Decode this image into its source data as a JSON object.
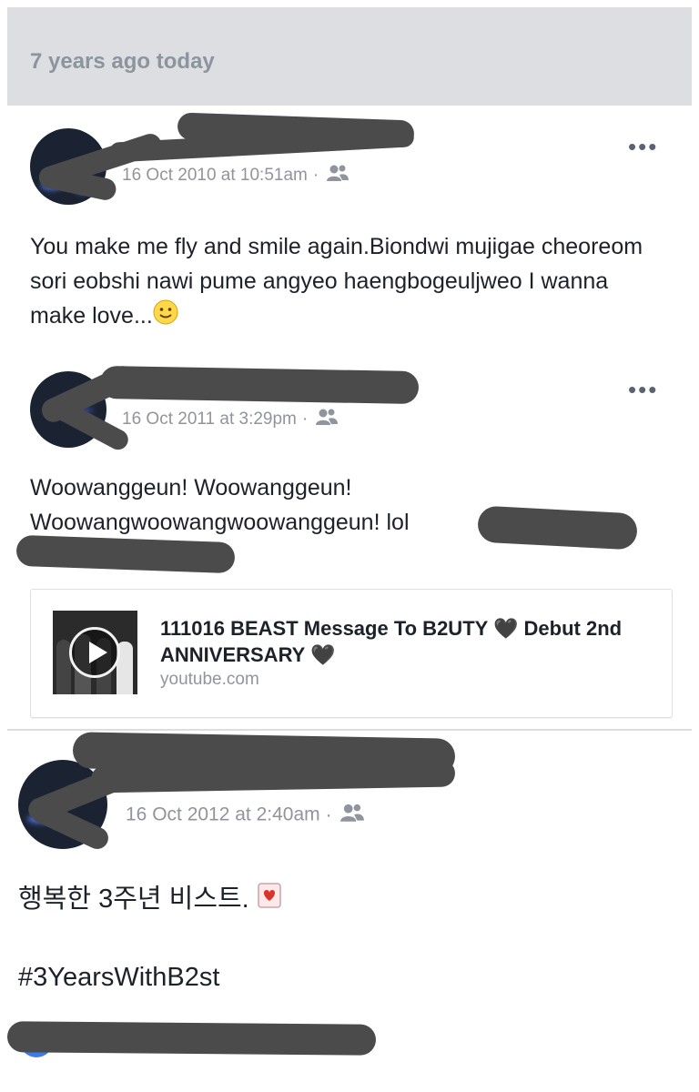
{
  "header": {
    "title": "7 years ago today"
  },
  "posts": [
    {
      "timestamp": "16 Oct 2010 at 10:51am",
      "separator": "·",
      "audience_icon": "friends-icon",
      "more_label": "•••",
      "text": "You make me fly and smile again.Biondwi mujigae cheoreom sori eobshi nawi pume angyeo haengbogeuljweo I wanna make love...",
      "emoji": "slightly-smiling-face"
    },
    {
      "timestamp": "16 Oct 2011 at 3:29pm",
      "separator": "·",
      "audience_icon": "friends-icon",
      "more_label": "•••",
      "text": "Woowanggeun! Woowanggeun! Woowangwoowangwoowanggeun! lol",
      "link": {
        "title": "111016 BEAST Message To B2UTY 🖤 Debut 2nd ANNIVERSARY 🖤",
        "domain": "youtube.com",
        "thumbnail_icon": "play-icon"
      }
    },
    {
      "timestamp": "16 Oct 2012 at 2:40am",
      "separator": "·",
      "audience_icon": "friends-icon",
      "line1": "행복한 3주년 비스트.",
      "emoji": "love-letter",
      "hashtag": "#3YearsWithB2st"
    }
  ],
  "colors": {
    "header_bg": "#dcdee1",
    "text": "#1d2129",
    "meta": "#90949c",
    "redaction": "#4b4b4b",
    "accent": "#3b7ce8"
  }
}
